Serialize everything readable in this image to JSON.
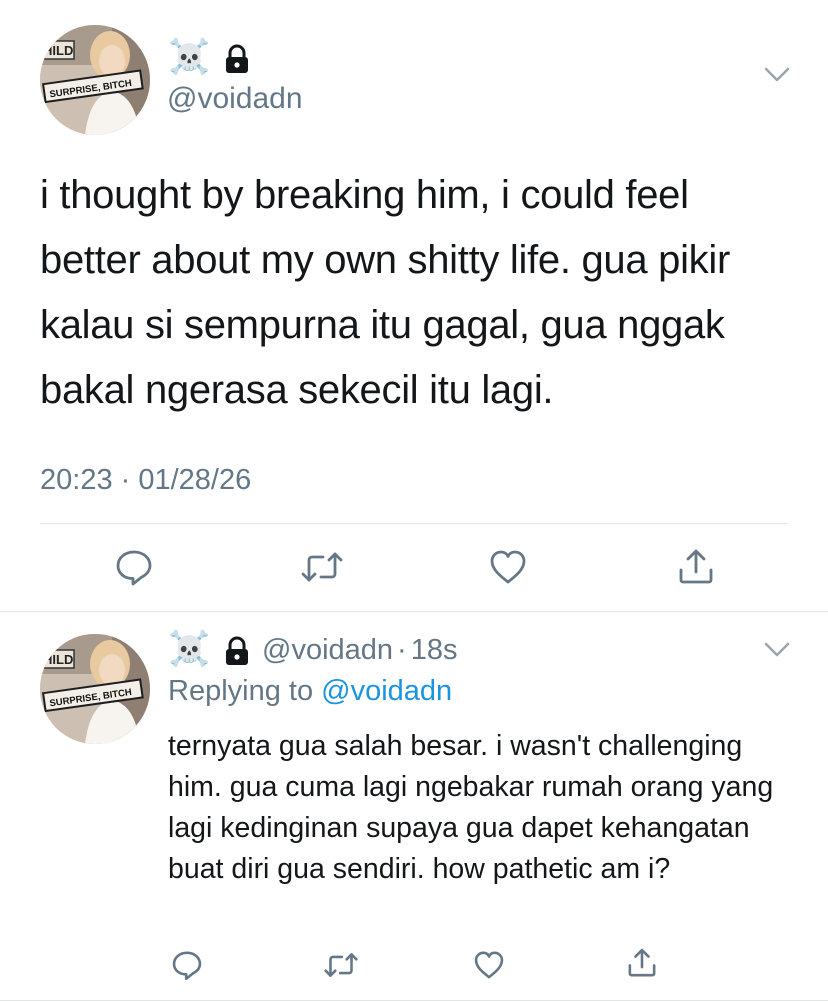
{
  "main_tweet": {
    "author_emojis": "☠️",
    "handle": "@voidadn",
    "avatar_sign_text": "SURPRISE, BITCH",
    "avatar_partial_text": "HILD",
    "text": "i thought by breaking him, i could feel better about my own shitty life. gua pikir kalau si sempurna itu gagal, gua nggak bakal ngerasa sekecil itu lagi.",
    "timestamp": "20:23 · 01/28/26"
  },
  "reply_tweet": {
    "author_emojis": "☠️",
    "handle": "@voidadn",
    "separator": "·",
    "time_ago": "18s",
    "replying_to_label": "Replying to",
    "replying_to_handle": "@voidadn",
    "text": "ternyata gua salah besar. i wasn't challenging him. gua cuma lagi ngebakar rumah orang yang lagi kedinginan supaya gua dapet kehangatan buat diri gua sendiri. how pathetic am i?"
  },
  "icons": {
    "reply": "reply-icon",
    "retweet": "retweet-icon",
    "like": "like-icon",
    "share": "share-icon",
    "menu": "chevron-down-icon",
    "lock": "lock-icon",
    "skull": "skull-emoji"
  },
  "colors": {
    "text_primary": "#14171a",
    "text_secondary": "#657786",
    "link": "#1b95e0",
    "icon": "#657786",
    "divider": "#e1e8ed"
  }
}
